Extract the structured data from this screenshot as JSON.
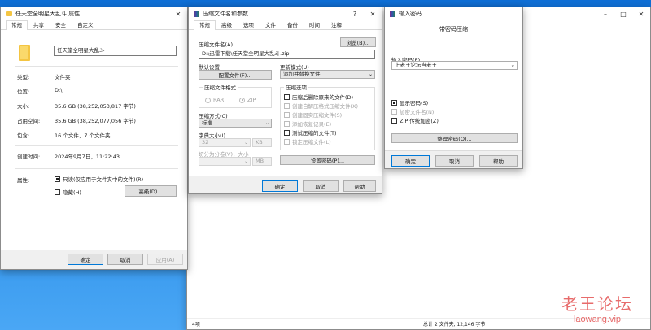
{
  "props": {
    "title": "任天堂全明星大乱斗 属性",
    "tabs": [
      "常规",
      "共享",
      "安全",
      "自定义"
    ],
    "name_value": "任天堂全明星大乱斗",
    "rows": [
      {
        "label": "类型:",
        "value": "文件夹"
      },
      {
        "label": "位置:",
        "value": "D:\\"
      },
      {
        "label": "大小:",
        "value": "35.6 GB (38,252,053,817 字节)"
      },
      {
        "label": "占用空间:",
        "value": "35.6 GB (38,252,077,056 字节)"
      },
      {
        "label": "包含:",
        "value": "16 个文件，7 个文件夹"
      },
      {
        "label": "创建时间:",
        "value": "2024年9月7日，11:22:43"
      }
    ],
    "attr_label": "属性:",
    "readonly_label": "只读(仅应用于文件夹中的文件)(R)",
    "hidden_label": "隐藏(H)",
    "advanced_button": "高级(D)...",
    "ok": "确定",
    "cancel": "取消",
    "apply": "应用(A)"
  },
  "archive": {
    "title": "压缩文件名和参数",
    "help_glyph": "?",
    "tabs": [
      "常规",
      "高级",
      "选项",
      "文件",
      "备份",
      "时间",
      "注释"
    ],
    "name_label": "压缩文件名(A)",
    "browse": "浏览(B)...",
    "name_value": "D:\\迅雷下载\\任天堂全明星大乱斗.zip",
    "default_settings": "默认设置",
    "profiles_button": "配置文件(F)...",
    "update_mode_label": "更新模式(U)",
    "update_mode_value": "添加并替换文件",
    "format_group": "压缩文件格式",
    "format_rar": "RAR",
    "format_zip": "ZIP",
    "method_label": "压缩方式(C)",
    "method_value": "标准",
    "dict_label": "字典大小(I)",
    "dict_value": "32",
    "dict_unit": "KB",
    "split_label": "切分为分卷(V)，大小",
    "split_unit": "MB",
    "options_group": "压缩选项",
    "options": [
      {
        "label": "压缩后删除原来的文件(D)",
        "checked": false,
        "disabled": false
      },
      {
        "label": "创建自解压格式压缩文件(X)",
        "checked": false,
        "disabled": true
      },
      {
        "label": "创建固实压缩文件(S)",
        "checked": false,
        "disabled": true
      },
      {
        "label": "添加恢复记录(E)",
        "checked": false,
        "disabled": true
      },
      {
        "label": "测试压缩的文件(T)",
        "checked": false,
        "disabled": false
      },
      {
        "label": "锁定压缩文件(L)",
        "checked": false,
        "disabled": true
      }
    ],
    "set_password": "设置密码(P)...",
    "ok": "确定",
    "cancel": "取消",
    "help": "帮助"
  },
  "password": {
    "title": "输入密码",
    "heading": "带密码压缩",
    "input_label": "输入密码(E)",
    "input_value": "上老王论坛当老王",
    "show_password": "显示密码(S)",
    "encrypt_names": "加密文件名(N)",
    "zip_legacy": "ZIP 传统加密(Z)",
    "organize": "整理密码(O)...",
    "ok": "确定",
    "cancel": "取消",
    "help": "帮助"
  },
  "explorer": {
    "status_left": "4项",
    "status_right": "总计 2 文件夹, 12,146 字节"
  },
  "watermark": {
    "line1": "老王论坛",
    "line2": "laowang.vip"
  },
  "colors": {
    "accent": "#0078d7",
    "folder": "#f4c542",
    "desktop": "#1a7fe0",
    "watermark": "#e03a3a"
  }
}
